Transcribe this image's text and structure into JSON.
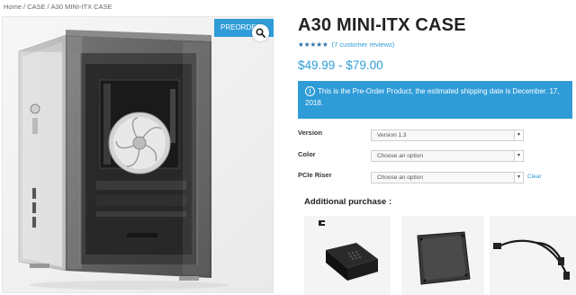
{
  "breadcrumb": {
    "items": [
      "Home",
      "CASE",
      "A30 MINI-ITX CASE"
    ],
    "separator": "/"
  },
  "gallery": {
    "badge": "PREORDER",
    "zoom_icon": "magnifier-icon"
  },
  "product": {
    "title": "A30 MINI-ITX CASE",
    "rating_stars": 4.5,
    "reviews_link": "(7 customer reviews)",
    "price_low": "$49.99",
    "price_dash": " - ",
    "price_high": "$79.00"
  },
  "notice": {
    "icon": "info-icon",
    "line1": "This is the Pre-Order Product, the estimated shipping date is December. 17,",
    "line2": "2018."
  },
  "options": {
    "version": {
      "label": "Version",
      "value": "Version 1.3"
    },
    "color": {
      "label": "Color",
      "value": "Choose an option"
    },
    "pcie": {
      "label": "PCIe Riser",
      "value": "Choose an option"
    },
    "clear_label": "Clear"
  },
  "additional": {
    "heading": "Additional purchase :"
  },
  "colors": {
    "accent": "#2f9cd8",
    "star": "#2f6fa5"
  }
}
